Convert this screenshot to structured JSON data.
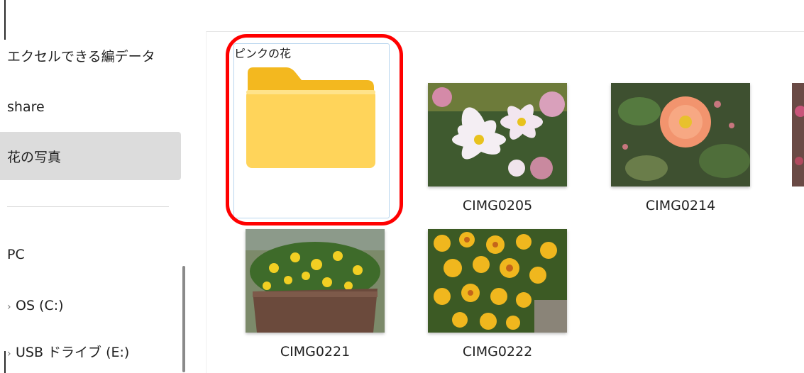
{
  "sidebar": {
    "items": [
      {
        "label": "エクセルできる編データ",
        "selected": false
      },
      {
        "label": "share",
        "selected": false
      },
      {
        "label": "花の写真",
        "selected": true
      },
      {
        "label": "PC",
        "selected": false
      },
      {
        "label": "OS (C:)",
        "selected": false
      },
      {
        "label": "USB ドライブ (E:)",
        "selected": false
      }
    ]
  },
  "files": [
    {
      "name": "ピンクの花",
      "kind": "folder",
      "selected": true
    },
    {
      "name": "CIMG0205",
      "kind": "image",
      "subject": "white and pink cosmos flowers"
    },
    {
      "name": "CIMG0214",
      "kind": "image",
      "subject": "orange rose with leaves"
    },
    {
      "name": "CIMG0221",
      "kind": "image",
      "subject": "yellow marigolds in wooden planter"
    },
    {
      "name": "CIMG0222",
      "kind": "image",
      "subject": "yellow and orange marigolds"
    }
  ],
  "colors": {
    "highlight": "#ff0000",
    "folder": "#ffd45a",
    "selection_bg": "#dcdcdc"
  }
}
